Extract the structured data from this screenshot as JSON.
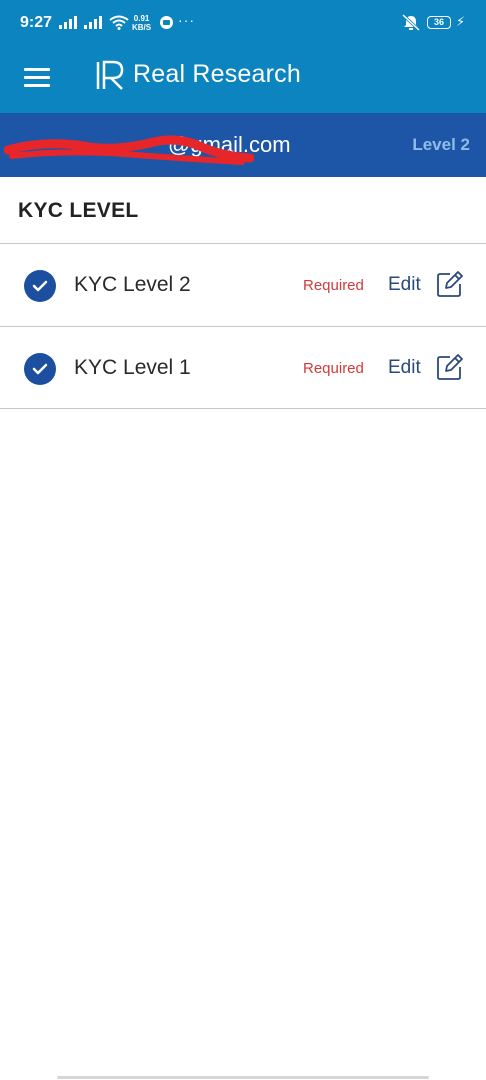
{
  "status_bar": {
    "time": "9:27",
    "net_speed_value": "0.91",
    "net_speed_unit": "KB/S",
    "more": "···",
    "battery": "36",
    "icons": [
      "signal-icon",
      "signal-icon",
      "wifi-icon",
      "messenger-icon",
      "mute-icon",
      "battery-icon",
      "charging-icon"
    ]
  },
  "app_bar": {
    "title": "Real Research",
    "menu_icon": "hamburger-menu-icon",
    "logo_icon": "real-research-logo-icon",
    "color": "#0b84bf"
  },
  "account": {
    "email": "@gmail.com",
    "level": "Level 2",
    "color": "#1d56a6"
  },
  "section": {
    "title": "KYC LEVEL"
  },
  "kyc_levels": [
    {
      "label": "KYC Level 2",
      "status": "Required",
      "action": "Edit"
    },
    {
      "label": "KYC Level 1",
      "status": "Required",
      "action": "Edit"
    }
  ],
  "colors": {
    "required": "#d23a3a",
    "check": "#1d4fa0"
  }
}
